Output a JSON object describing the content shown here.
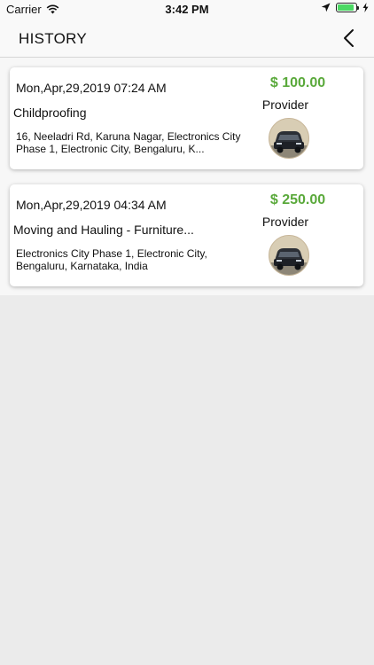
{
  "status_bar": {
    "carrier": "Carrier",
    "time": "3:42 PM"
  },
  "header": {
    "title": "HISTORY"
  },
  "history": [
    {
      "datetime": "Mon,Apr,29,2019 07:24 AM",
      "service": "Childproofing",
      "address": "16, Neeladri Rd, Karuna Nagar, Electronics City Phase 1, Electronic City, Bengaluru, K...",
      "price": "$ 100.00",
      "role": "Provider"
    },
    {
      "datetime": "Mon,Apr,29,2019 04:34 AM",
      "service": "Moving and Hauling - Furniture...",
      "address": "Electronics City Phase 1, Electronic City, Bengaluru, Karnataka, India",
      "price": "$ 250.00",
      "role": "Provider"
    }
  ],
  "colors": {
    "price": "#5aa93b",
    "background": "#ebebeb",
    "battery": "#4cd964"
  },
  "icons": {
    "wifi": "wifi-icon",
    "location": "location-arrow-icon",
    "battery": "battery-icon",
    "charging": "charging-bolt-icon",
    "back": "chevron-left-icon",
    "avatar": "provider-car-avatar"
  }
}
